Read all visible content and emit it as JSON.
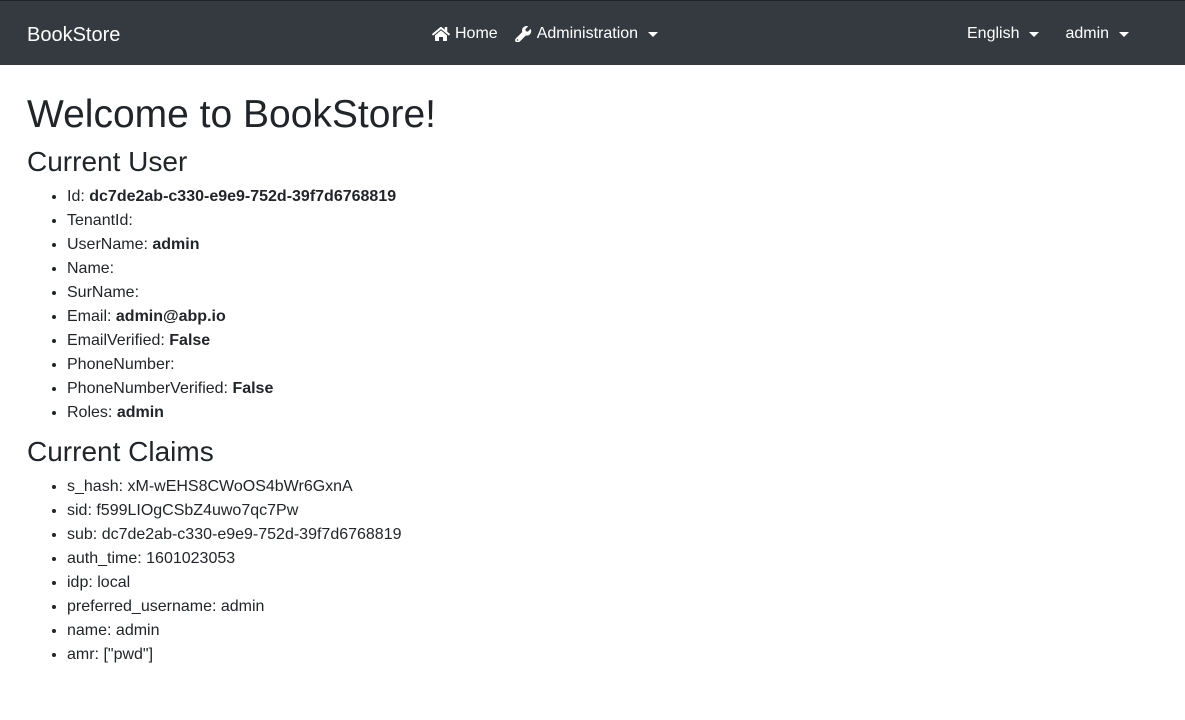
{
  "navbar": {
    "brand": "BookStore",
    "home_label": "Home",
    "admin_label": "Administration",
    "language_label": "English",
    "user_label": "admin",
    "icons": {
      "home": "home-icon",
      "admin": "wrench-icon"
    },
    "background": "#343a40"
  },
  "page": {
    "title": "Welcome to BookStore!",
    "current_user_heading": "Current User",
    "current_claims_heading": "Current Claims"
  },
  "current_user": [
    {
      "label": "Id:",
      "value": "dc7de2ab-c330-e9e9-752d-39f7d6768819"
    },
    {
      "label": "TenantId:",
      "value": ""
    },
    {
      "label": "UserName:",
      "value": "admin"
    },
    {
      "label": "Name:",
      "value": ""
    },
    {
      "label": "SurName:",
      "value": ""
    },
    {
      "label": "Email:",
      "value": "admin@abp.io"
    },
    {
      "label": "EmailVerified:",
      "value": "False"
    },
    {
      "label": "PhoneNumber:",
      "value": ""
    },
    {
      "label": "PhoneNumberVerified:",
      "value": "False"
    },
    {
      "label": "Roles:",
      "value": "admin"
    }
  ],
  "current_claims": [
    "s_hash: xM-wEHS8CWoOS4bWr6GxnA",
    "sid: f599LIOgCSbZ4uwo7qc7Pw",
    "sub: dc7de2ab-c330-e9e9-752d-39f7d6768819",
    "auth_time: 1601023053",
    "idp: local",
    "preferred_username: admin",
    "name: admin",
    "amr: [\"pwd\"]"
  ]
}
